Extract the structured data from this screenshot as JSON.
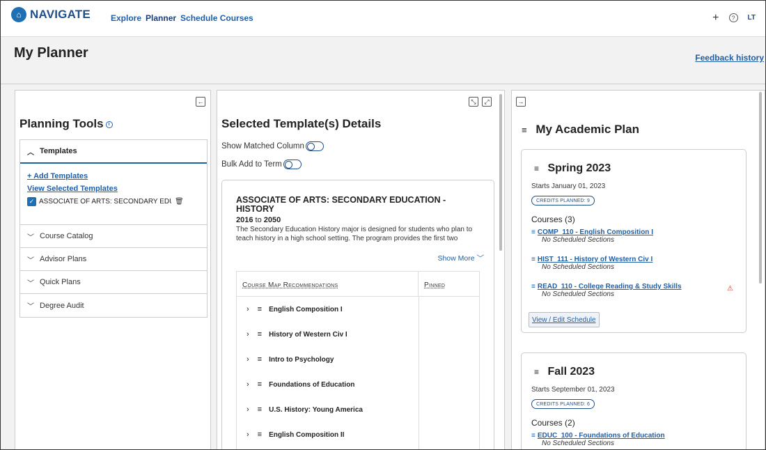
{
  "nav": {
    "logo_text": "NAVIGATE",
    "links": [
      "Explore",
      "Planner",
      "Schedule Courses"
    ],
    "avatar": "LT"
  },
  "page": {
    "title": "My Planner",
    "feedback_link": "Feedback history"
  },
  "left_panel": {
    "title": "Planning Tools",
    "templates_header": "Templates",
    "add_templates": "+ Add Templates",
    "view_selected": "View Selected Templates",
    "selected_template": "ASSOCIATE OF ARTS: SECONDARY EDUCATIC",
    "sections": [
      "Course Catalog",
      "Advisor Plans",
      "Quick Plans",
      "Degree Audit"
    ]
  },
  "mid_panel": {
    "title": "Selected Template(s) Details",
    "toggle_matched": "Show Matched Column",
    "toggle_bulk": "Bulk Add to Term",
    "template": {
      "title": "ASSOCIATE OF ARTS: SECONDARY EDUCATION - HISTORY",
      "year_start": "2016",
      "year_to": "to",
      "year_end": "2050",
      "description": "The Secondary Education History major is designed for students who plan to teach history in a high school setting. The program provides the first two",
      "show_more": "Show More"
    },
    "table": {
      "col1": "Course Map Recommendations",
      "col2": "Pinned",
      "rows": [
        "English Composition I",
        "History of Western Civ I",
        "Intro to Psychology",
        "Foundations of Education",
        "U.S. History: Young America",
        "English Composition II"
      ]
    }
  },
  "right_panel": {
    "title": "My Academic Plan",
    "terms": [
      {
        "name": "Spring 2023",
        "start": "Starts January 01, 2023",
        "credits": "CREDITS PLANNED: 9",
        "courses_label": "Courses (3)",
        "courses": [
          {
            "title": "COMP_110 - English Composition I",
            "status": "No Scheduled Sections"
          },
          {
            "title": "HIST_111 - History of Western Civ I",
            "status": "No Scheduled Sections"
          },
          {
            "title": "READ_110 - College Reading & Study Skills",
            "status": "No Scheduled Sections"
          }
        ],
        "button": "View / Edit Schedule"
      },
      {
        "name": "Fall 2023",
        "start": "Starts September 01, 2023",
        "credits": "CREDITS PLANNED: 6",
        "courses_label": "Courses (2)",
        "courses": [
          {
            "title": "EDUC_100 - Foundations of Education",
            "status": "No Scheduled Sections"
          }
        ]
      }
    ]
  },
  "colors": {
    "brand": "#1f4e8c",
    "link": "#1f5fa8",
    "warning": "#d0352c"
  }
}
